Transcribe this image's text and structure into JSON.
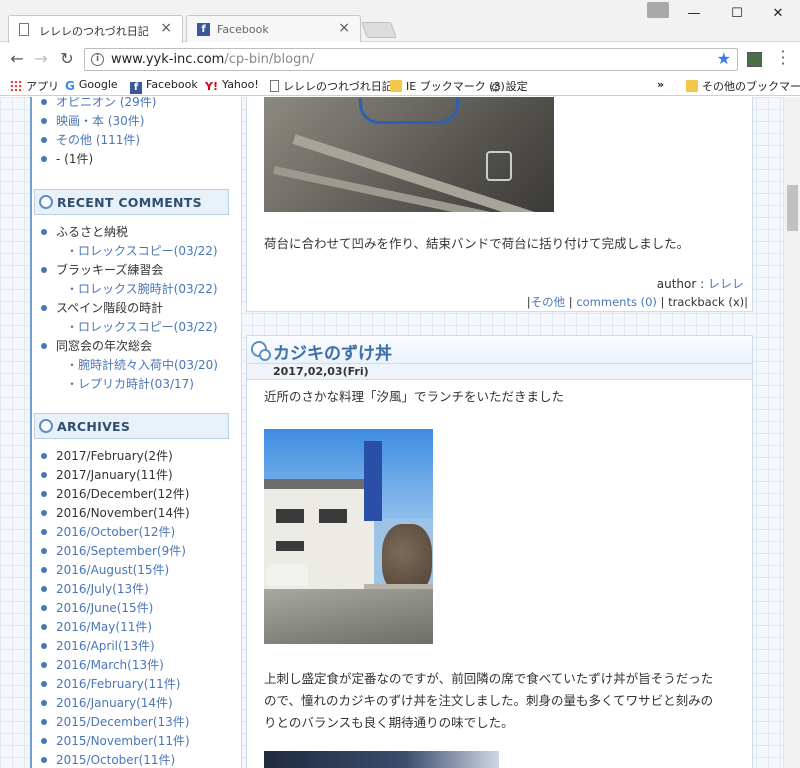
{
  "browser": {
    "tabs": [
      {
        "title": "レレレのつれづれ日記",
        "active": true
      },
      {
        "title": "Facebook",
        "active": false
      }
    ],
    "url_host": "www.yyk-inc.com",
    "url_path": "/cp-bin/blogn/",
    "window_controls": {
      "minimize": "—",
      "maximize": "☐",
      "close": "✕"
    }
  },
  "bookmarks": [
    {
      "label": "アプリ",
      "icon": "apps-icon"
    },
    {
      "label": "Google",
      "icon": "google-icon"
    },
    {
      "label": "Facebook",
      "icon": "facebook-icon"
    },
    {
      "label": "Yahoo!",
      "icon": "yahoo-icon"
    },
    {
      "label": "レレレのつれづれ日記",
      "icon": "page-icon"
    },
    {
      "label": "IE ブックマーク (3)",
      "icon": "folder-icon"
    },
    {
      "label": "設定",
      "icon": "gear-icon"
    },
    {
      "label": "»",
      "icon": "more-icon"
    },
    {
      "label": "その他のブックマーク",
      "icon": "folder-icon"
    }
  ],
  "sidebar": {
    "categories": [
      {
        "label": "オピニオン",
        "count": "(29件)"
      },
      {
        "label": "映画・本",
        "count": "(30件)"
      },
      {
        "label": "その他",
        "count": "(111件)"
      },
      {
        "label": "-",
        "count": "(1件)"
      }
    ],
    "recent_comments_header": "RECENT COMMENTS",
    "recent_comments": [
      {
        "post": "ふるさと納税",
        "comments": [
          "・ロレックスコピー(03/22)"
        ]
      },
      {
        "post": "ブラッキーズ練習会",
        "comments": [
          "・ロレックス腕時計(03/22)"
        ]
      },
      {
        "post": "スペイン階段の時計",
        "comments": [
          "・ロレックスコピー(03/22)"
        ]
      },
      {
        "post": "同窓会の年次総会",
        "comments": [
          "・腕時計続々入荷中(03/20)",
          "・レプリカ時計(03/17)"
        ]
      }
    ],
    "archives_header": "ARCHIVES",
    "archives": [
      "2017/February(2件)",
      "2017/January(11件)",
      "2016/December(12件)",
      "2016/November(14件)",
      "2016/October(12件)",
      "2016/September(9件)",
      "2016/August(15件)",
      "2016/July(13件)",
      "2016/June(15件)",
      "2016/May(11件)",
      "2016/April(13件)",
      "2016/March(13件)",
      "2016/February(11件)",
      "2016/January(14件)",
      "2015/December(13件)",
      "2015/November(11件)",
      "2015/October(11件)"
    ]
  },
  "entry1": {
    "body": "荷台に合わせて凹みを作り、結束バンドで荷台に括り付けて完成しました。",
    "author_label": "author :",
    "author_name": "レレレ",
    "meta_category": "その他",
    "meta_comments": "comments (0)",
    "meta_trackback": "trackback (x)"
  },
  "entry2": {
    "title": "カジキのずけ丼",
    "date": "2017,02,03(Fri)",
    "intro": "近所のさかな料理「汐風」でランチをいただきました",
    "body_lines": [
      "上刺し盛定食が定番なのですが、前回隣の席で食べていたずけ丼が旨そうだった",
      "ので、憧れのカジキのずけ丼を注文しました。刺身の量も多くてワサビと刻みの",
      "りとのバランスも良く期待通りの味でした。"
    ]
  },
  "colors": {
    "link": "#4a76b8",
    "title": "#3c6ea8",
    "sidebar_border": "#6ea0d0",
    "header_bg": "#e8f1fa"
  }
}
